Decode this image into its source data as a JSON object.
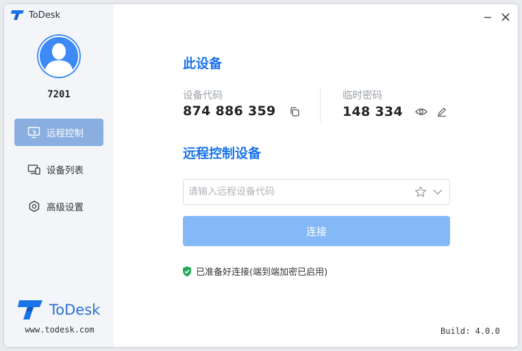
{
  "app": {
    "title": "ToDesk"
  },
  "user": {
    "name": "7201"
  },
  "sidebar": {
    "items": [
      {
        "label": "远程控制",
        "icon": "remote-control-icon",
        "active": true
      },
      {
        "label": "设备列表",
        "icon": "device-list-icon",
        "active": false
      },
      {
        "label": "高级设置",
        "icon": "settings-gear-icon",
        "active": false
      }
    ],
    "brand": "ToDesk",
    "website": "www.todesk.com"
  },
  "device": {
    "section_title": "此设备",
    "code_label": "设备代码",
    "code_value": "874 886 359",
    "password_label": "临时密码",
    "password_value": "148 334"
  },
  "remote": {
    "section_title": "远程控制设备",
    "input_placeholder": "请输入远程设备代码",
    "input_value": "",
    "connect_label": "连接"
  },
  "status": {
    "text": "已准备好连接(端到端加密已启用)"
  },
  "build": "Build: 4.0.0",
  "colors": {
    "accent": "#1a73e8",
    "connect_button": "#85b8f6",
    "active_nav": "#8aaee0",
    "avatar_bg": "#3d8af7",
    "status_ok": "#23a857"
  }
}
